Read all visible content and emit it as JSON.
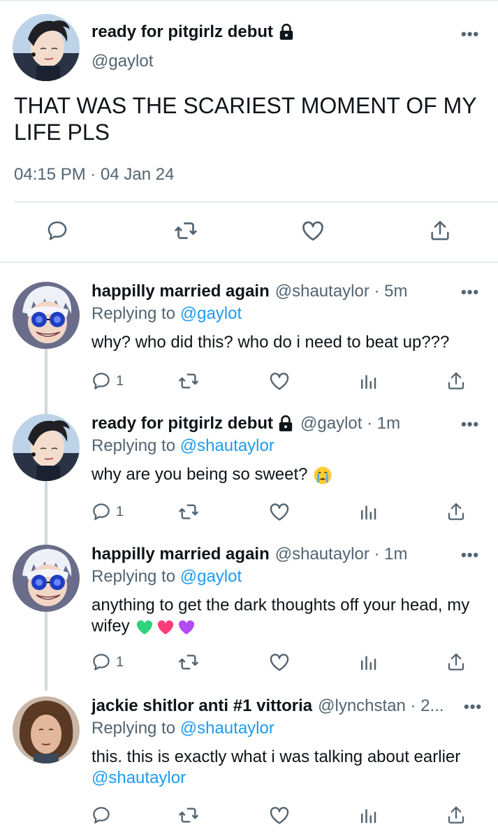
{
  "main_tweet": {
    "name": "ready for pitgirlz debut",
    "handle": "@gaylot",
    "text": "THAT WAS THE SCARIEST MOMENT OF MY LIFE PLS",
    "timestamp": "04:15 PM · 04 Jan 24",
    "more": "•••"
  },
  "replies": [
    {
      "name": "happilly married again",
      "handle_time": "@shautaylor · 5m",
      "replying_label": "Replying to",
      "replying_to": "@gaylot",
      "text": "why? who did this? who do i need to beat up???",
      "reply_count": "1",
      "more": "•••"
    },
    {
      "name": "ready for pitgirlz debut",
      "handle_time": "@gaylot · 1m",
      "replying_label": "Replying to",
      "replying_to": "@shautaylor",
      "text": "why are you being so sweet?",
      "reply_count": "1",
      "more": "•••"
    },
    {
      "name": "happilly married again",
      "handle_time": "@shautaylor · 1m",
      "replying_label": "Replying to",
      "replying_to": "@gaylot",
      "text": "anything to get the dark thoughts off your head, my wifey",
      "reply_count": "1",
      "more": "•••"
    },
    {
      "name": "jackie shitlor anti #1 vittoria",
      "handle_time": "@lynchstan · 2...",
      "replying_label": "Replying to",
      "replying_to": "@shautaylor",
      "text": "this. this is exactly what i was talking about earlier",
      "text_mention": "@shautaylor",
      "more": "•••"
    }
  ],
  "colors": {
    "text": "#0f1419",
    "secondary": "#536471",
    "link": "#1d9bf0",
    "divider": "#e6ecf0",
    "thread_line": "#cfd9de"
  },
  "icons": {
    "reply": "comment-icon",
    "retweet": "retweet-icon",
    "like": "heart-icon",
    "analytics": "analytics-icon",
    "share": "share-icon",
    "lock": "lock-icon"
  }
}
